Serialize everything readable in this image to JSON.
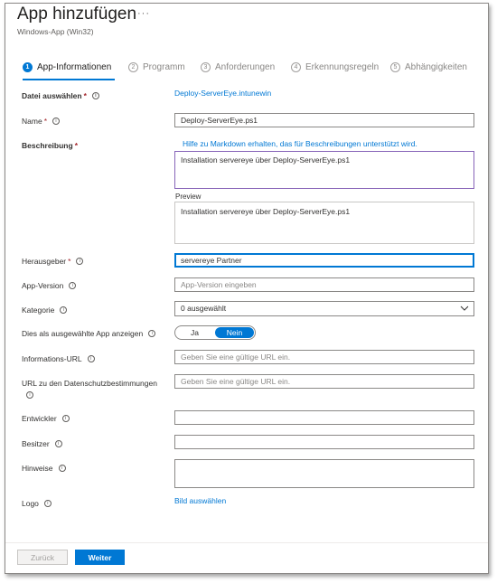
{
  "header": {
    "title": "App hinzufügen",
    "more": "···",
    "subtitle": "Windows-App (Win32)"
  },
  "steps": [
    {
      "num": "1",
      "label": "App-Informationen",
      "active": true
    },
    {
      "num": "2",
      "label": "Programm"
    },
    {
      "num": "3",
      "label": "Anforderungen"
    },
    {
      "num": "4",
      "label": "Erkennungsregeln"
    },
    {
      "num": "5",
      "label": "Abhängigkeiten"
    }
  ],
  "form": {
    "file": {
      "label": "Datei auswählen",
      "required": "*",
      "link": "Deploy-ServerEye.intunewin"
    },
    "name": {
      "label": "Name",
      "required": "*",
      "value": "Deploy-ServerEye.ps1"
    },
    "description": {
      "label": "Beschreibung",
      "required": "*",
      "help_link": "Hilfe zu Markdown erhalten, das für Beschreibungen unterstützt wird.",
      "value": "Installation servereye über Deploy-ServerEye.ps1",
      "preview_label": "Preview",
      "preview_text": "Installation servereye über Deploy-ServerEye.ps1"
    },
    "publisher": {
      "label": "Herausgeber",
      "required": "*",
      "value": "servereye Partner"
    },
    "app_version": {
      "label": "App-Version",
      "placeholder": "App-Version eingeben"
    },
    "category": {
      "label": "Kategorie",
      "value": "0 ausgewählt"
    },
    "featured": {
      "label": "Dies als ausgewählte App anzeigen",
      "option_yes": "Ja",
      "option_no": "Nein",
      "selected": "Nein"
    },
    "info_url": {
      "label": "Informations-URL",
      "placeholder": "Geben Sie eine gültige URL ein."
    },
    "privacy_url": {
      "label": "URL zu den Datenschutzbestimmungen",
      "placeholder": "Geben Sie eine gültige URL ein."
    },
    "developer": {
      "label": "Entwickler"
    },
    "owner": {
      "label": "Besitzer"
    },
    "notes": {
      "label": "Hinweise"
    },
    "logo": {
      "label": "Logo",
      "link": "Bild auswählen"
    }
  },
  "info_glyph": "i",
  "footer": {
    "back_label": "Zurück",
    "next_label": "Weiter"
  },
  "colors": {
    "accent": "#0078d4",
    "required": "#a4262c",
    "description_border": "#8764b8"
  }
}
